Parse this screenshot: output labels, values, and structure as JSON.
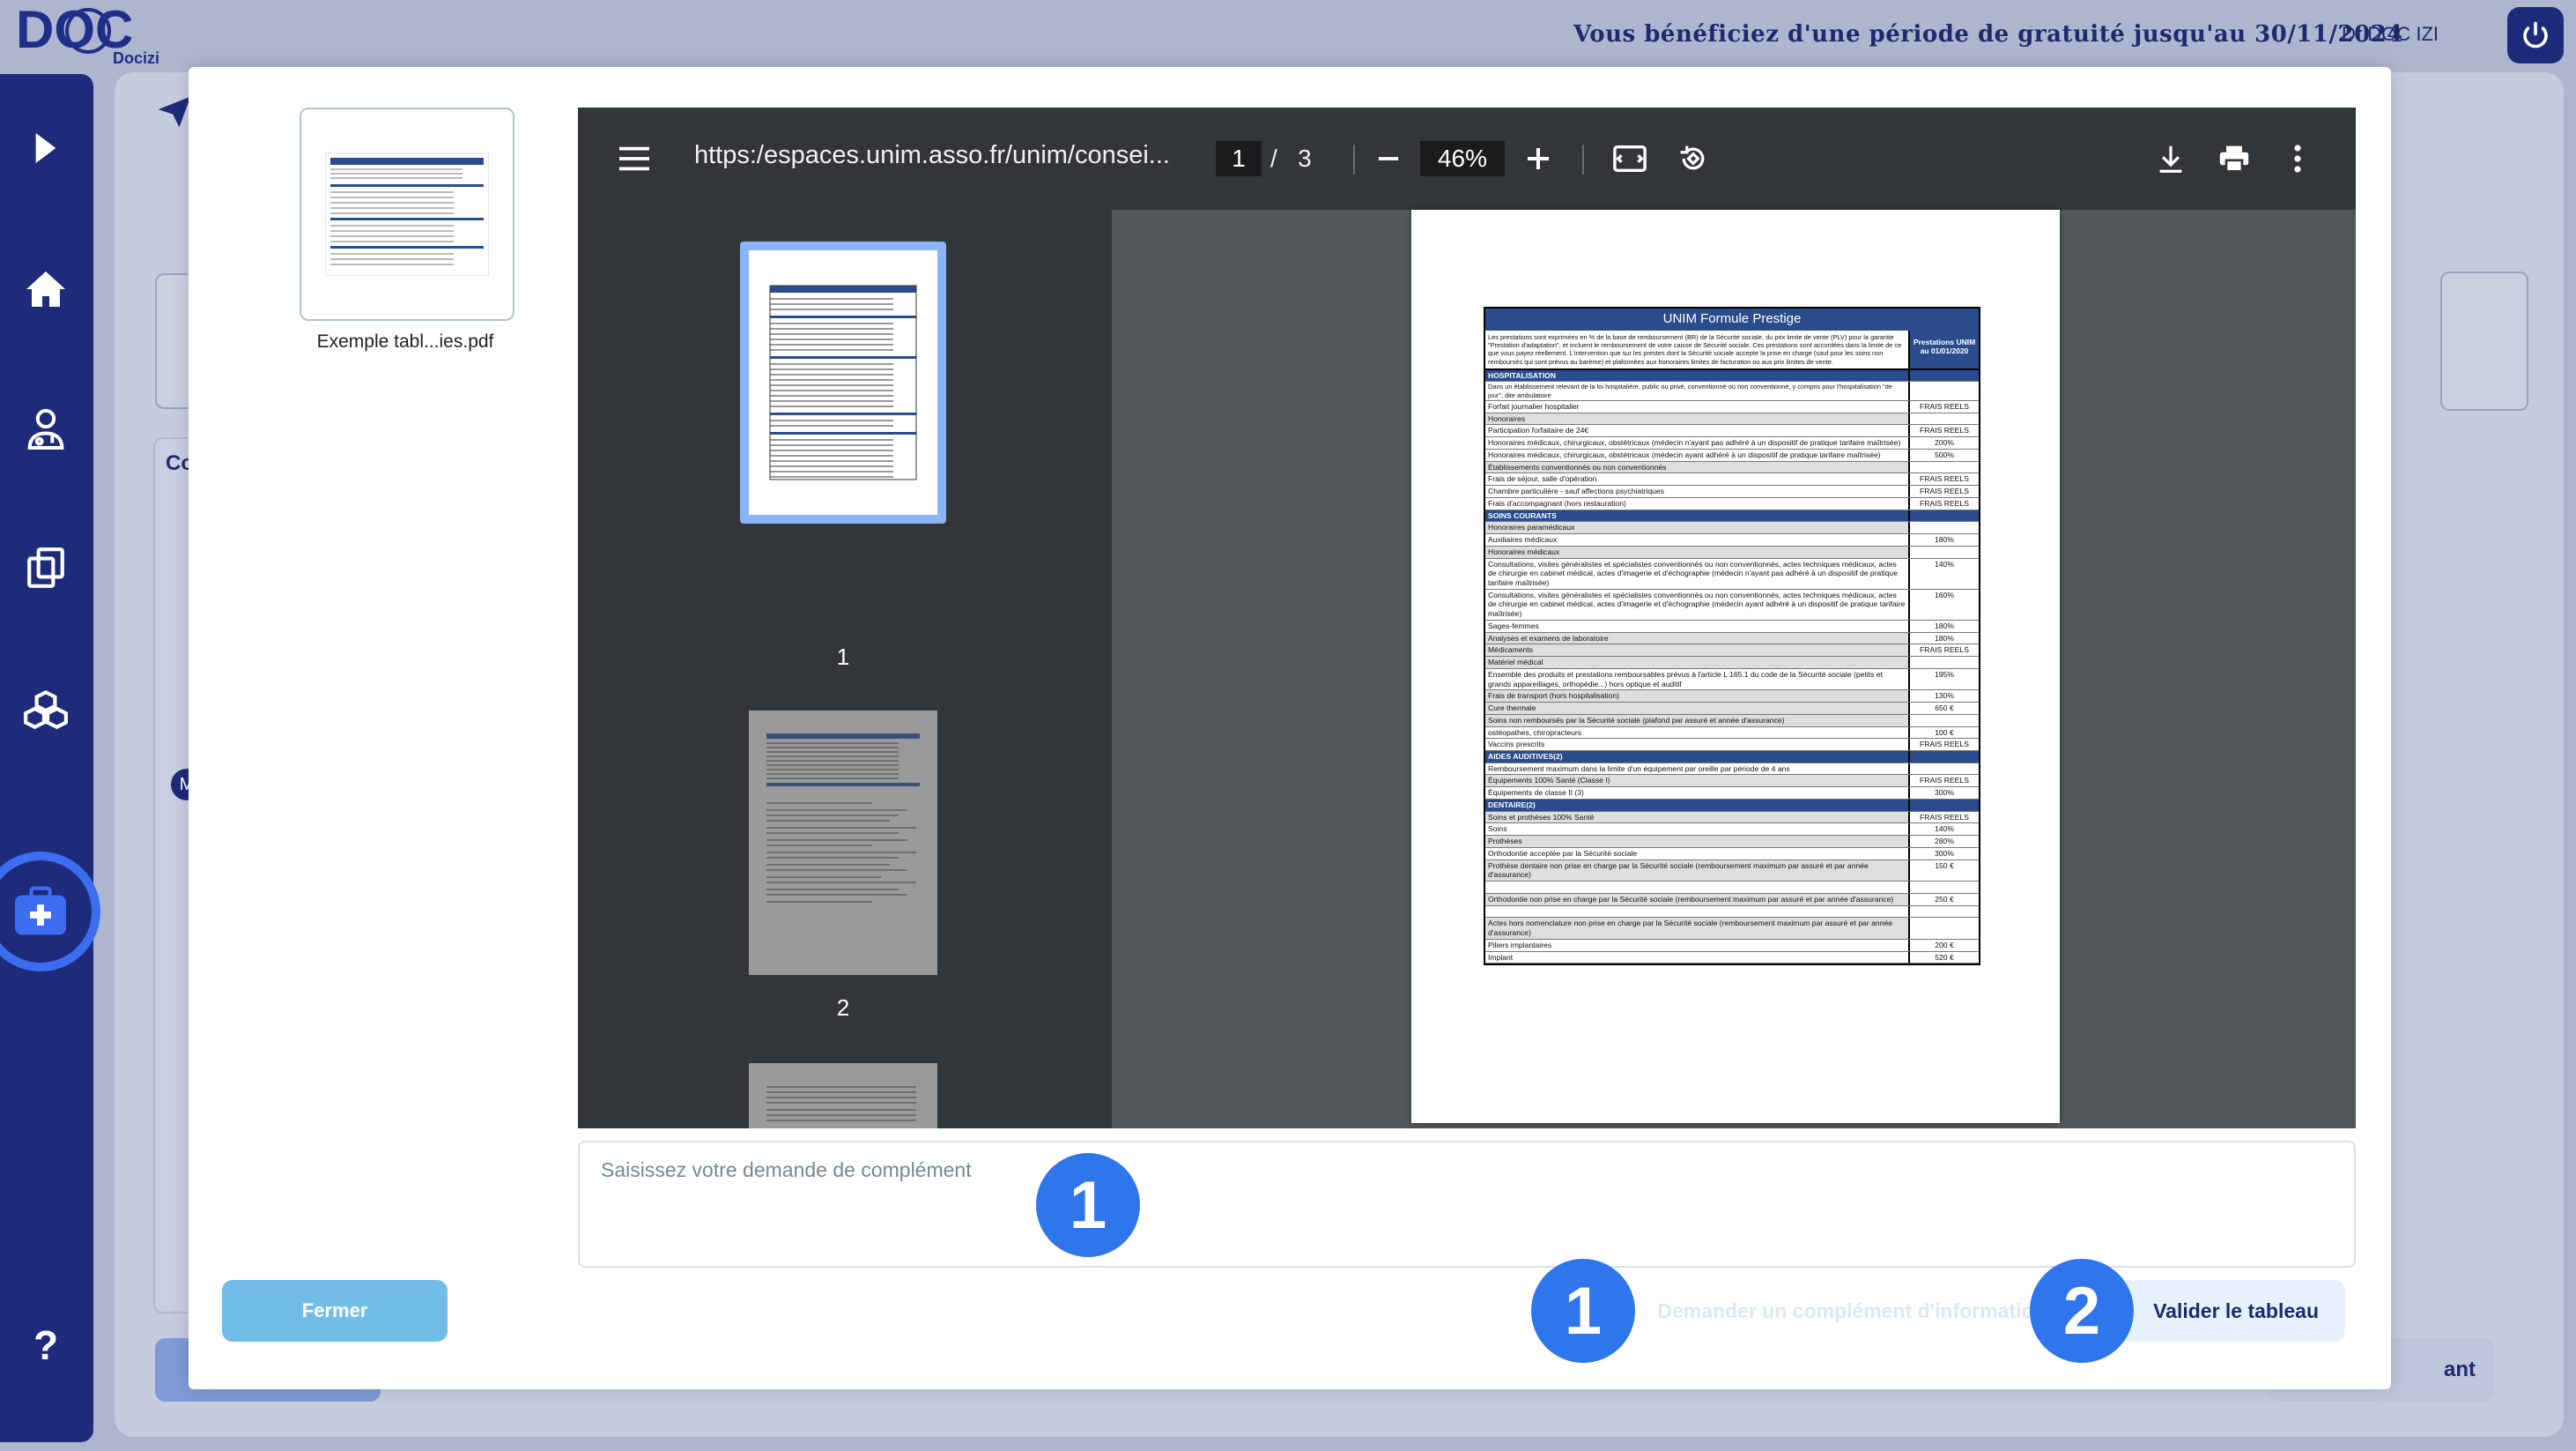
{
  "app": {
    "logo_text": "DOC",
    "logo_sub": "Docizi",
    "trial_banner": "Vous bénéficiez d'une période de gratuité jusqu'au 30/11/2024",
    "user_name": "Dr DOC IZI",
    "bg_section_label": "Co",
    "bg_avatar_letter": "M",
    "bg_next_button": "ant",
    "brand_color": "#1d2b7a"
  },
  "sidebar": {
    "items": [
      {
        "icon": "chevron-right-icon"
      },
      {
        "icon": "home-icon"
      },
      {
        "icon": "doctor-icon"
      },
      {
        "icon": "documents-icon"
      },
      {
        "icon": "cubes-icon"
      },
      {
        "icon": "medical-kit-icon",
        "active": true
      },
      {
        "icon": "help-icon",
        "label": "?"
      }
    ]
  },
  "modal": {
    "file_name": "Exemple tabl...ies.pdf",
    "viewer": {
      "url": "https:/espaces.unim.asso.fr/unim/consei...",
      "current_page": "1",
      "page_sep": "/",
      "total_pages": "3",
      "zoom": "46%",
      "thumb_labels": [
        "1",
        "2"
      ]
    },
    "document": {
      "title": "UNIM Formule Prestige",
      "intro": "Les prestations sont exprimées en % de la base de remboursement (BR) de la Sécurité sociale, du prix limite de vente (PLV) pour la garantie \"Prestation d'adaptation\", et incluent le remboursement de votre caisse de Sécurité sociale. Ces prestations sont accordées dans la limite de ce que vous payez réellement. L'intervention que sur les prestes dont la Sécurité sociale accepte la prise en charge (sauf pour les soins non remboursés qui sont prévus au barème) et plafonnées aux honoraires limites de facturation ou aux prix limites de vente.",
      "head_right": "Prestations UNIM au 01/01/2020",
      "rows": [
        {
          "type": "sec",
          "label": "HOSPITALISATION",
          "value": ""
        },
        {
          "type": "note",
          "label": "Dans un établissement relevant de la loi hospitalière, public ou privé, conventionné ou non conventionné, y compris pour l'hospitalisation \"de jour\", dite ambulatoire",
          "value": ""
        },
        {
          "type": "row",
          "label": "Forfait journalier hospitalier",
          "value": "FRAIS REELS"
        },
        {
          "type": "sub",
          "label": "Honoraires",
          "value": ""
        },
        {
          "type": "row",
          "label": "Participation forfaitaire de 24€",
          "value": "FRAIS REELS"
        },
        {
          "type": "row",
          "label": "Honoraires médicaux, chirurgicaux, obstétricaux (médecin n'ayant pas adhéré à un dispositif de pratique tarifaire maîtrisée)",
          "value": "200%"
        },
        {
          "type": "row",
          "label": "Honoraires médicaux, chirurgicaux, obstétricaux (médecin ayant adhéré à un dispositif de pratique tarifaire maîtrisée)",
          "value": "500%"
        },
        {
          "type": "sub",
          "label": "Établissements conventionnés ou non conventionnés",
          "value": ""
        },
        {
          "type": "row",
          "label": "Frais de séjour, salle d'opération",
          "value": "FRAIS REELS"
        },
        {
          "type": "row",
          "label": "Chambre particulière - sauf affections psychiatriques",
          "value": "FRAIS REELS"
        },
        {
          "type": "row",
          "label": "Frais d'accompagnant (hors restauration)",
          "value": "FRAIS REELS"
        },
        {
          "type": "sec",
          "label": "SOINS COURANTS",
          "value": ""
        },
        {
          "type": "sub",
          "label": "Honoraires paramédicaux",
          "value": ""
        },
        {
          "type": "row",
          "label": "Auxiliaires médicaux",
          "value": "180%"
        },
        {
          "type": "sub",
          "label": "Honoraires médicaux",
          "value": ""
        },
        {
          "type": "row",
          "label": "Consultations, visites généralistes et spécialistes conventionnés ou non conventionnés, actes techniques médicaux, actes de chirurgie en cabinet médical, actes d'imagerie et d'échographie (médecin n'ayant pas adhéré à un dispositif de pratique tarifaire maîtrisée)",
          "value": "140%"
        },
        {
          "type": "row",
          "label": "Consultations, visites généralistes et spécialistes conventionnés ou non conventionnés, actes techniques médicaux, actes de chirurgie en cabinet médical, actes d'imagerie et d'échographie (médecin ayant adhéré à un dispositif de pratique tarifaire maîtrisée)",
          "value": "160%"
        },
        {
          "type": "row",
          "label": "Sages-femmes",
          "value": "180%"
        },
        {
          "type": "sub",
          "label": "Analyses et examens de laboratoire",
          "value": "180%"
        },
        {
          "type": "sub",
          "label": "Médicaments",
          "value": "FRAIS REELS"
        },
        {
          "type": "sub",
          "label": "Matériel médical",
          "value": ""
        },
        {
          "type": "row",
          "label": "Ensemble des produits et prestations remboursables prévus à l'article L 165.1 du code de la Sécurité sociale (petits et grands appareillages, orthopédie...) hors optique et auditif",
          "value": "195%"
        },
        {
          "type": "sub",
          "label": "Frais de transport (hors hospitalisation)",
          "value": "130%"
        },
        {
          "type": "sub",
          "label": "Cure thermale",
          "value": "650 €"
        },
        {
          "type": "sub",
          "label": "Soins non remboursés par la Sécurité sociale (plafond par assuré et année d'assurance)",
          "value": ""
        },
        {
          "type": "row",
          "label": "ostéopathes, chiropracteurs",
          "value": "100 €"
        },
        {
          "type": "row",
          "label": "Vaccins prescrits",
          "value": "FRAIS REELS"
        },
        {
          "type": "sec",
          "label": "AIDES AUDITIVES(2)",
          "value": ""
        },
        {
          "type": "row",
          "label": "Remboursement maximum dans la limite d'un équipement par oreille par période de 4 ans",
          "value": ""
        },
        {
          "type": "sub",
          "label": "Équipements 100% Santé (Classe I)",
          "value": "FRAIS REELS"
        },
        {
          "type": "row",
          "label": "Équipements de classe II (3)",
          "value": "300%"
        },
        {
          "type": "sec",
          "label": "DENTAIRE(2)",
          "value": ""
        },
        {
          "type": "sub",
          "label": "Soins et prothèses 100% Santé",
          "value": "FRAIS REELS"
        },
        {
          "type": "row",
          "label": "Soins",
          "value": "140%"
        },
        {
          "type": "sub",
          "label": "Prothèses",
          "value": "280%"
        },
        {
          "type": "row",
          "label": "Orthodontie acceptée par la Sécurité sociale",
          "value": "300%"
        },
        {
          "type": "sub",
          "label": "Prothèse dentaire non prise en charge par la Sécurité sociale (remboursement maximum par assuré et par année d'assurance)",
          "value": "150 €"
        },
        {
          "type": "row",
          "label": "",
          "value": ""
        },
        {
          "type": "sub",
          "label": "Orthodontie non prise en charge par la Sécurité sociale (remboursement maximum par assuré et par année d'assurance)",
          "value": "250 €"
        },
        {
          "type": "row",
          "label": "",
          "value": ""
        },
        {
          "type": "sub",
          "label": "Actes hors nomenclature non prise en charge par la Sécurité sociale (remboursement maximum par assuré et par année d'assurance)",
          "value": ""
        },
        {
          "type": "row",
          "label": "Piliers implantaires",
          "value": "200 €"
        },
        {
          "type": "row",
          "label": "Implant",
          "value": "520 €"
        }
      ]
    },
    "textarea_placeholder": "Saisissez votre demande de complément",
    "close_button": "Fermer",
    "request_button": "Demander un complément d'information",
    "validate_button": "Valider le tableau",
    "callouts": [
      "1",
      "1",
      "2"
    ]
  }
}
